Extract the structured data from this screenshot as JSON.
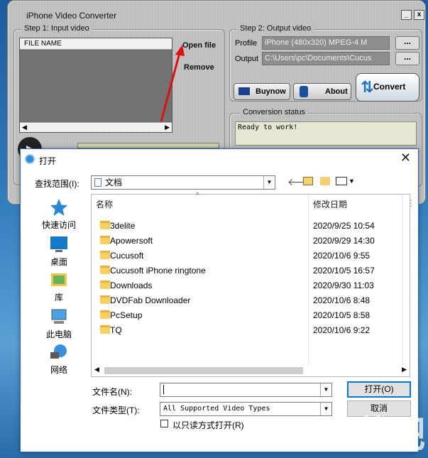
{
  "app": {
    "title": "iPhone Video Converter",
    "minimize": "_",
    "close": "x",
    "step1": "Step 1: Input video",
    "file_name_header": "FILE NAME",
    "open_file": "Open file",
    "remove": "Remove",
    "step2": "Step 2: Output video",
    "profile_label": "Profile",
    "profile_value": "iPhone (480x320) MPEG-4 M",
    "output_label": "Output",
    "output_value": "C:\\Users\\pc\\Documents\\Cucus",
    "browse": "...",
    "buynow": "Buynow",
    "about": "About",
    "convert": "Convert",
    "conversion_status": "Conversion status",
    "status_text": "Ready to work!"
  },
  "dialog": {
    "title": "打开",
    "close": "✕",
    "look_in_label": "查找范围(I):",
    "look_in_value": "文档",
    "places": [
      "快速访问",
      "桌面",
      "库",
      "此电脑",
      "网络"
    ],
    "columns": {
      "name": "名称",
      "date": "修改日期"
    },
    "rows": [
      {
        "name": "3delite",
        "date": "2020/9/25 10:54"
      },
      {
        "name": "Apowersoft",
        "date": "2020/9/29 14:30"
      },
      {
        "name": "Cucusoft",
        "date": "2020/10/6 9:55"
      },
      {
        "name": "Cucusoft iPhone ringtone",
        "date": "2020/10/5 16:57"
      },
      {
        "name": "Downloads",
        "date": "2020/9/30 11:03"
      },
      {
        "name": "DVDFab Downloader",
        "date": "2020/10/6 8:48"
      },
      {
        "name": "PcSetup",
        "date": "2020/10/5 8:58"
      },
      {
        "name": "TQ",
        "date": "2020/10/6 9:22"
      }
    ],
    "file_name_label": "文件名(N):",
    "file_name_value": "",
    "file_type_label": "文件类型(T):",
    "file_type_value": "All Supported Video Types",
    "readonly_label": "以只读方式打开(R)",
    "open_button": "打开(O)",
    "cancel_button": "取消"
  },
  "colors": {
    "accent": "#0078d7",
    "status_bg": "#e6e6d2",
    "folder": "#f7cf62"
  }
}
